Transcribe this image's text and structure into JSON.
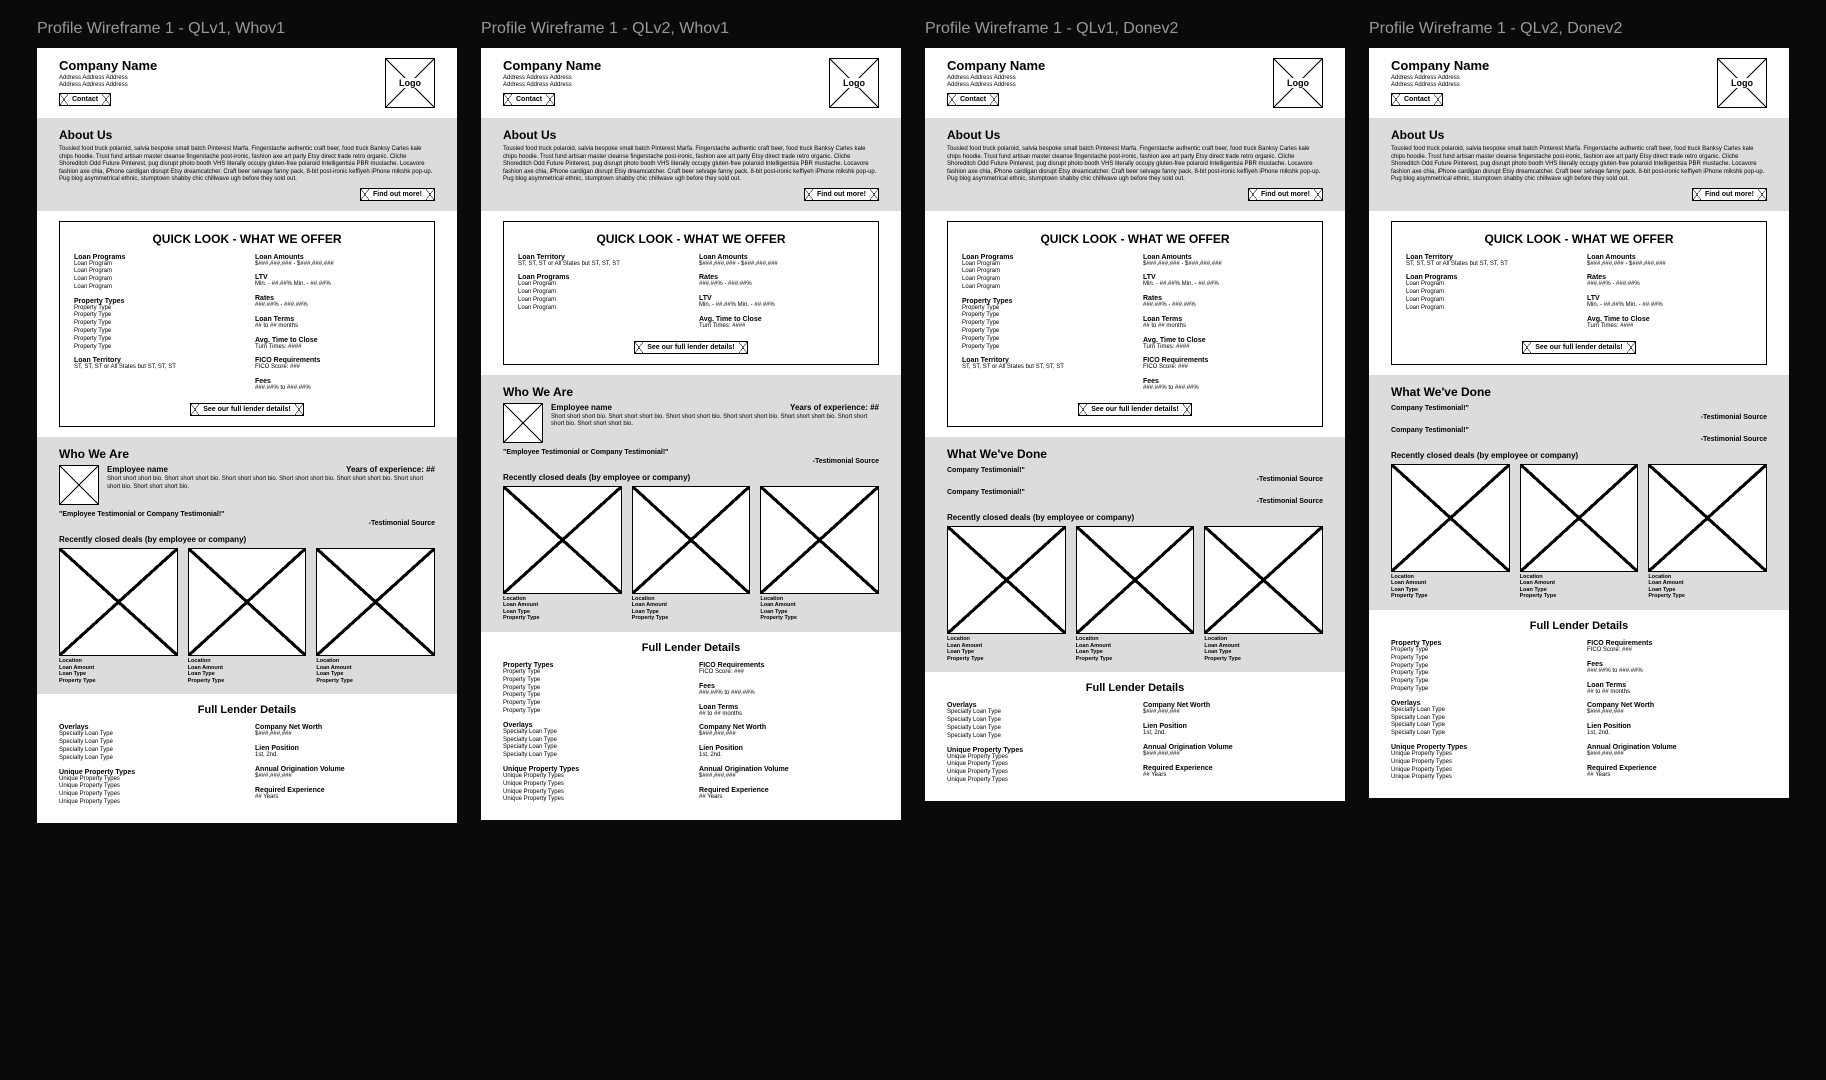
{
  "frames": [
    {
      "title": "Profile Wireframe 1 - QLv1, Whov1",
      "ql": "v1",
      "after_ql": "who"
    },
    {
      "title": "Profile Wireframe 1 - QLv2, Whov1",
      "ql": "v2",
      "after_ql": "who"
    },
    {
      "title": "Profile Wireframe 1 - QLv1, Donev2",
      "ql": "v1",
      "after_ql": "done"
    },
    {
      "title": "Profile Wireframe 1 - QLv2, Donev2",
      "ql": "v2",
      "after_ql": "done"
    }
  ],
  "header": {
    "company": "Company Name",
    "addr1": "Address Address Address",
    "addr2": "Address Address Address",
    "logo": "Logo",
    "contact_btn": "Contact"
  },
  "about": {
    "heading": "About Us",
    "body": "Tousled food truck polaroid, salvia bespoke small batch Pinterest Marfa. Fingerstache authentic craft beer, food truck Banksy Carles kale chips hoodie. Trust fund artisan master cleanse fingerstache post-ironic, fashion axe art party Etsy direct trade retro organic. Cliche Shoreditch Odd Future Pinterest, pug disrupt photo booth VHS literally occupy gluten-free polaroid Intelligentsia PBR mustache. Locavore fashion axe chia, iPhone cardigan disrupt Etsy dreamcatcher. Craft beer selvage fanny pack, 8-bit post-ironic keffiyeh iPhone mlkshk pop-up. Pug blog asymmetrical ethnic, stumptown shabby chic chillwave ugh before they sold out.",
    "btn": "Find out more!"
  },
  "quicklook": {
    "title": "QUICK LOOK - WHAT WE OFFER",
    "btn": "See our full lender details!",
    "loan_programs": {
      "label": "Loan Programs",
      "items": [
        "Loan Program",
        "Loan Program",
        "Loan Program",
        "Loan Program"
      ]
    },
    "property_types": {
      "label": "Property Types",
      "items": [
        "Property Type",
        "Property Type",
        "Property Type",
        "Property Type",
        "Property Type",
        "Property Type"
      ]
    },
    "loan_territory": {
      "label": "Loan Territory",
      "val_v1": "ST, ST, ST or All States but ST, ST, ST",
      "val_v2": "ST, ST, ST or All States but ST, ST, ST"
    },
    "loan_amounts": {
      "label": "Loan Amounts",
      "val": "$###,###,### - $###,###,###"
    },
    "ltv": {
      "label": "LTV",
      "val": "Min. - ##.##%     Min. - ##.##%"
    },
    "rates": {
      "label": "Rates",
      "val": "###.##% - ###.##%"
    },
    "loan_terms": {
      "label": "Loan Terms",
      "val": "## to ## months"
    },
    "avg_close": {
      "label": "Avg. Time to Close",
      "val": "Turn Times: ####"
    },
    "fico": {
      "label": "FICO Requirements",
      "val": "FICO Score: ###"
    },
    "fees": {
      "label": "Fees",
      "val": "###.##% to ###.##%"
    }
  },
  "who": {
    "heading": "Who We Are",
    "emp_name": "Employee name",
    "years": "Years of experience: ##",
    "bio": "Short short short bio. Short short short bio. Short short short bio. Short short short bio. Short short short bio. Short short short bio. Short short short bio.",
    "quote": "\"Employee Testimonial or Company Testimonial!\"",
    "src": "-Testimonial Source",
    "deals_heading": "Recently closed deals (by employee or company)"
  },
  "done": {
    "heading": "What We've Done",
    "quote": "Company Testimonial!\"",
    "src": "-Testimonial Source",
    "deals_heading": "Recently closed deals (by employee or company)"
  },
  "deal": {
    "lines": [
      "Location",
      "Loan Amount",
      "Loan Type",
      "Property Type"
    ]
  },
  "fld": {
    "title": "Full Lender Details",
    "overlays": {
      "label": "Overlays",
      "items": [
        "Specialty Loan Type",
        "Specialty Loan Type",
        "Specialty Loan Type",
        "Specialty Loan Type"
      ]
    },
    "unique_property": {
      "label": "Unique Property Types",
      "items": [
        "Unique Property Types",
        "Unique Property Types",
        "Unique Property Types",
        "Unique Property Types"
      ]
    },
    "property_types_long": {
      "label": "Property Types",
      "items": [
        "Property Type",
        "Property Type",
        "Property Type",
        "Property Type",
        "Property Type",
        "Property Type"
      ]
    },
    "net_worth": {
      "label": "Company Net Worth",
      "val": "$###,###,###"
    },
    "lien": {
      "label": "Lien Position",
      "val": "1st, 2nd."
    },
    "aov": {
      "label": "Annual Origination Volume",
      "val": "$###,###,###"
    },
    "req_exp": {
      "label": "Required Experience",
      "val": "## Years"
    },
    "fico": {
      "label": "FICO Requirements",
      "val": "FICO Score: ###"
    },
    "fees": {
      "label": "Fees",
      "val": "###.##% to ###.##%"
    },
    "loan_terms": {
      "label": "Loan Terms",
      "val": "## to ## months"
    }
  }
}
